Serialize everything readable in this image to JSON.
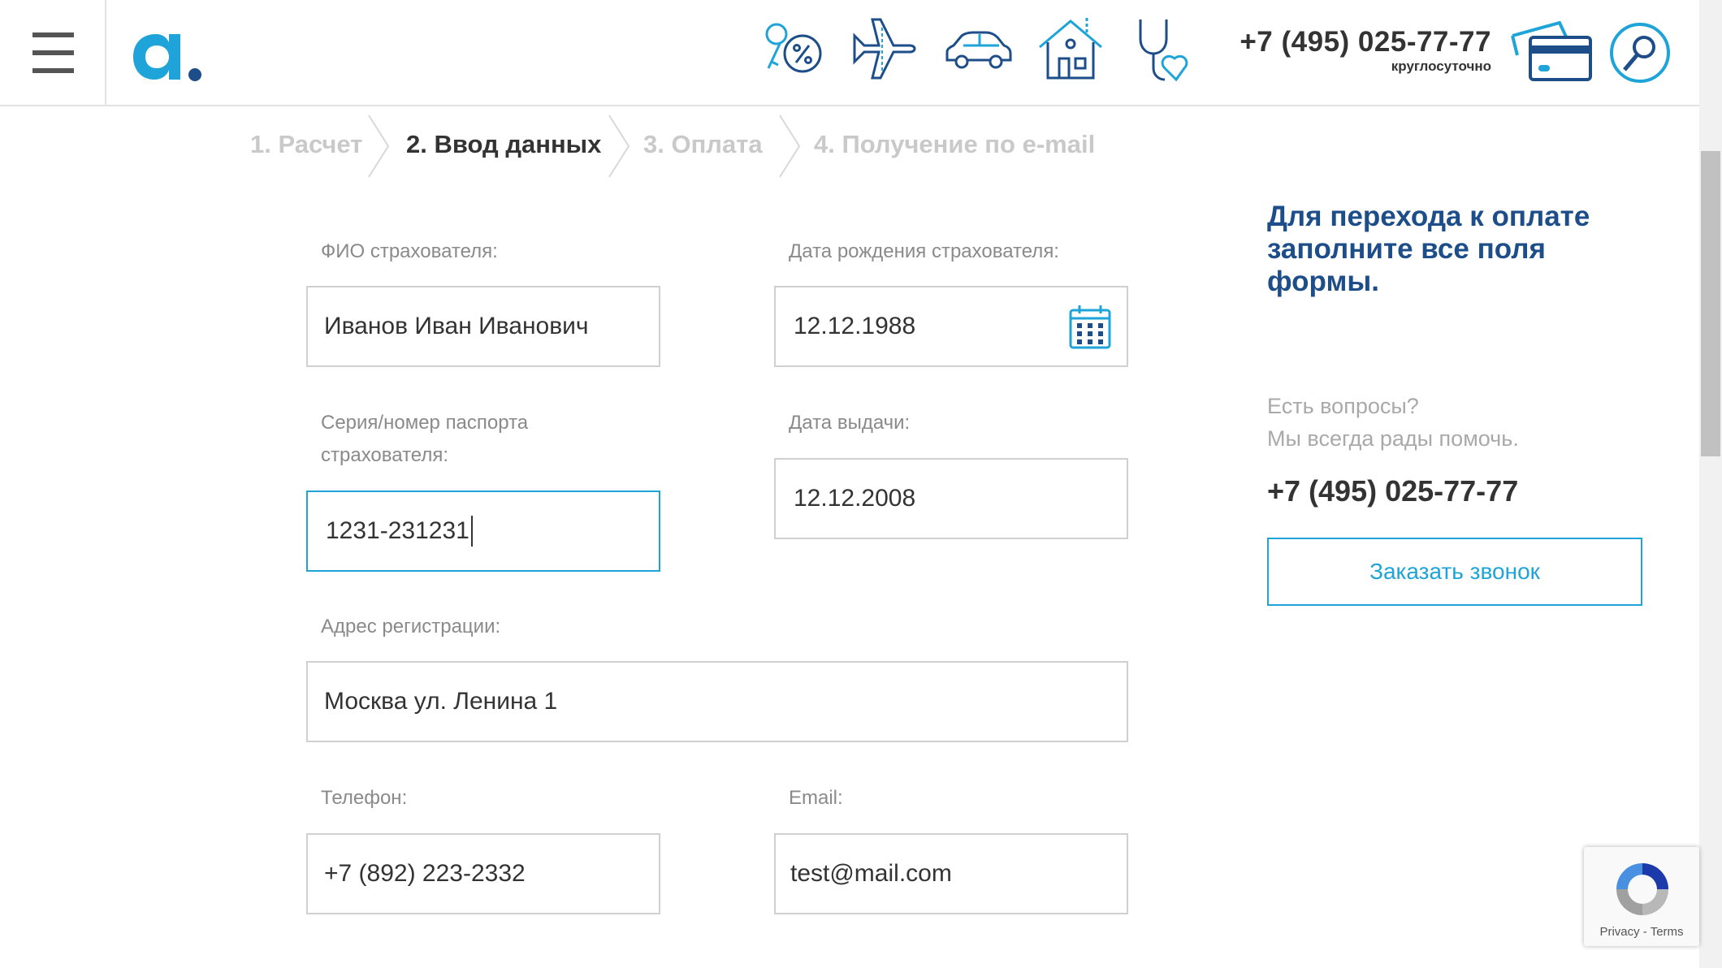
{
  "header": {
    "phone": "+7 (495) 025-77-77",
    "phone_sub": "круглосуточно",
    "nav_icons": [
      "key-percent-icon",
      "plane-icon",
      "car-icon",
      "house-icon",
      "stethoscope-heart-icon"
    ],
    "colors": {
      "accent": "#1ea4d8",
      "brand_dark": "#1d4e89"
    }
  },
  "steps": [
    {
      "label": "1. Расчет",
      "active": false
    },
    {
      "label": "2. Ввод данных",
      "active": true
    },
    {
      "label": "3. Оплата",
      "active": false
    },
    {
      "label": "4. Получение по e-mail",
      "active": false
    }
  ],
  "form": {
    "fio": {
      "label": "ФИО страхователя:",
      "value": "Иванов Иван Иванович"
    },
    "birth_date": {
      "label": "Дата рождения страхователя:",
      "value": "12.12.1988"
    },
    "passport": {
      "label_line1": "Серия/номер паспорта",
      "label_line2": "страхователя:",
      "value": "1231-231231"
    },
    "issue_date": {
      "label": "Дата выдачи:",
      "value": "12.12.2008"
    },
    "address": {
      "label": "Адрес регистрации:",
      "value": "Москва ул. Ленина 1"
    },
    "phone": {
      "label": "Телефон:",
      "value": "+7 (892) 223-2332"
    },
    "email": {
      "label": "Email:",
      "value": "test@mail.com"
    }
  },
  "sidebar": {
    "title": "Для перехода к оплате заполните все поля формы.",
    "question_line1": "Есть вопросы?",
    "question_line2": "Мы всегда рады помочь.",
    "phone": "+7 (495) 025-77-77",
    "callback_label": "Заказать звонок"
  },
  "recaptcha": {
    "privacy": "Privacy",
    "separator": " - ",
    "terms": "Terms"
  }
}
